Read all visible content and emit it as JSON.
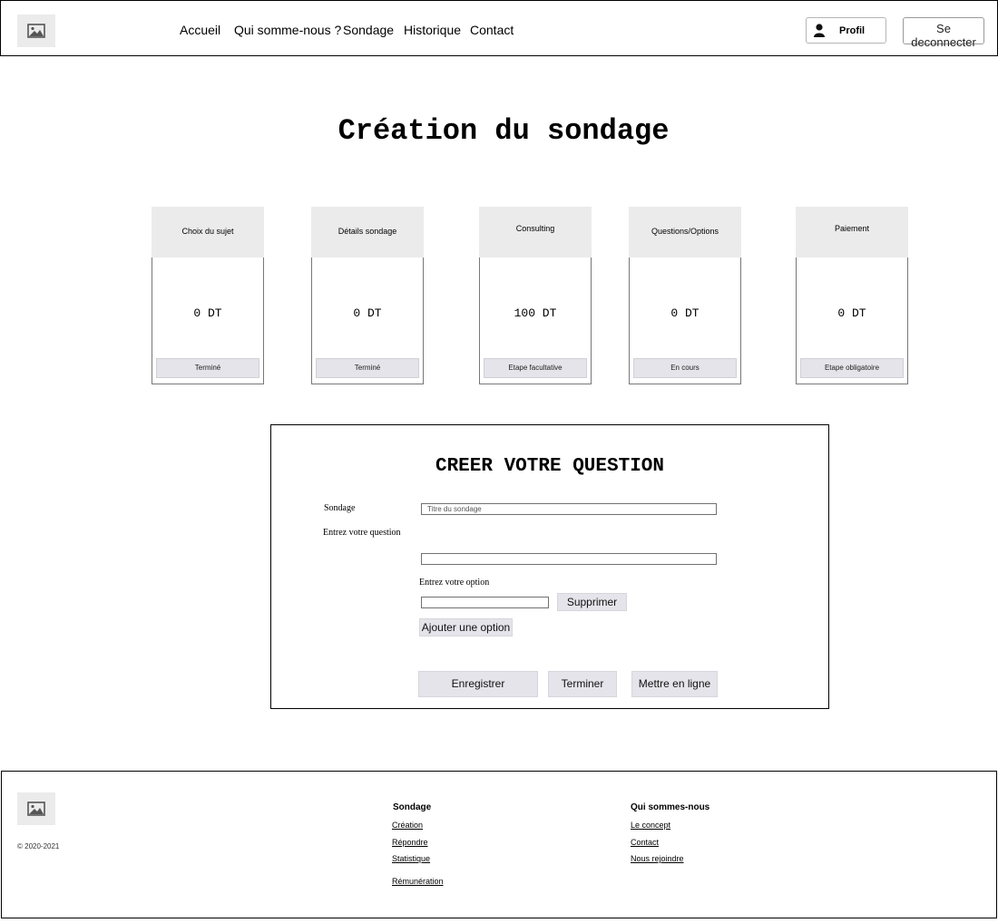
{
  "header": {
    "nav": [
      "Accueil",
      "Qui somme-nous ?",
      "Sondage",
      "Historique",
      "Contact"
    ],
    "profile_label": "Profil",
    "logout_label": "Se deconnecter"
  },
  "page_title": "Création du sondage",
  "steps": [
    {
      "title": "Choix du sujet",
      "price": "0  DT",
      "status": "Terminé"
    },
    {
      "title": "Détails sondage",
      "price": "0  DT",
      "status": "Terminé"
    },
    {
      "title": "Consulting",
      "price": "100  DT",
      "status": "Etape facultative"
    },
    {
      "title": "Questions/Options",
      "price": "0  DT",
      "status": "En cours"
    },
    {
      "title": "Paiement",
      "price": "0  DT",
      "status": "Etape obligatoire"
    }
  ],
  "form": {
    "title": "CREER VOTRE QUESTION",
    "sondage_label": "Sondage",
    "sondage_placeholder": "Titre du sondage",
    "question_label": "Entrez votre question",
    "question_value": "",
    "option_label": "Entrez votre option",
    "option_value": "",
    "delete_label": "Supprimer",
    "add_option_label": "Ajouter une option",
    "save_label": "Enregistrer",
    "finish_label": "Terminer",
    "publish_label": "Mettre en ligne"
  },
  "footer": {
    "copyright": "© 2020-2021",
    "col1": {
      "heading": "Sondage",
      "links": [
        "Création",
        "Répondre",
        "Statistique",
        "Rémunération"
      ]
    },
    "col2": {
      "heading": "Qui sommes-nous",
      "links": [
        "Le concept",
        "Contact",
        "Nous rejoindre"
      ]
    }
  }
}
